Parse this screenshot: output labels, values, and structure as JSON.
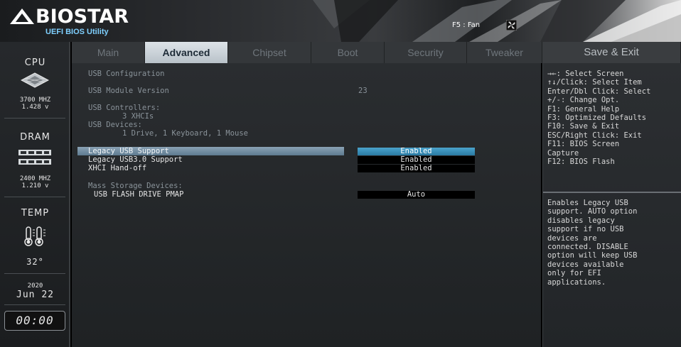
{
  "header": {
    "brand": "BIOSTAR",
    "subtitle": "UEFI BIOS Utility",
    "fan_hint": "F5 : Fan"
  },
  "sidebar": {
    "cpu": {
      "label": "CPU",
      "freq": "3700 MHZ",
      "volt": "1.428 v"
    },
    "dram": {
      "label": "DRAM",
      "freq": "2400 MHZ",
      "volt": "1.210 v"
    },
    "temp": {
      "label": "TEMP",
      "value": "32°"
    },
    "date": {
      "year": "2020",
      "month_day": "Jun 22"
    },
    "clock": "00:00"
  },
  "tabs": [
    {
      "label": "Main"
    },
    {
      "label": "Advanced"
    },
    {
      "label": "Chipset"
    },
    {
      "label": "Boot"
    },
    {
      "label": "Security"
    },
    {
      "label": "Tweaker"
    },
    {
      "label": "Save & Exit"
    }
  ],
  "main": {
    "section_title": "USB Configuration",
    "module_version_label": "USB Module Version",
    "module_version_value": "23",
    "controllers_label": "USB Controllers:",
    "controllers_value": "3 XHCIs",
    "devices_label": "USB Devices:",
    "devices_value": "1 Drive, 1 Keyboard, 1 Mouse",
    "options": [
      {
        "label": "Legacy USB Support",
        "value": "Enabled"
      },
      {
        "label": "Legacy USB3.0 Support",
        "value": "Enabled"
      },
      {
        "label": "XHCI Hand-off",
        "value": "Enabled"
      }
    ],
    "mass_storage_label": "Mass Storage Devices:",
    "mass_device_label": "USB FLASH DRIVE PMAP",
    "mass_device_value": "Auto"
  },
  "help": {
    "keys": [
      "→←: Select Screen",
      "↑↓/Click: Select Item",
      "Enter/Dbl Click: Select",
      "+/-: Change Opt.",
      "F1: General Help",
      "F3: Optimized Defaults",
      "F10: Save & Exit",
      "ESC/Right Click: Exit",
      "F11: BIOS Screen",
      "Capture",
      "F12: BIOS Flash"
    ],
    "description": [
      "Enables Legacy USB",
      "support. AUTO option",
      "disables legacy",
      "support if no USB",
      "devices are",
      "connected. DISABLE",
      "option will keep USB",
      "devices available",
      "only for EFI",
      "applications."
    ]
  },
  "colors": {
    "accent": "#2a7aa3",
    "highlight_bar": "#6f8fa6",
    "logo_blue": "#7fd0ff"
  }
}
